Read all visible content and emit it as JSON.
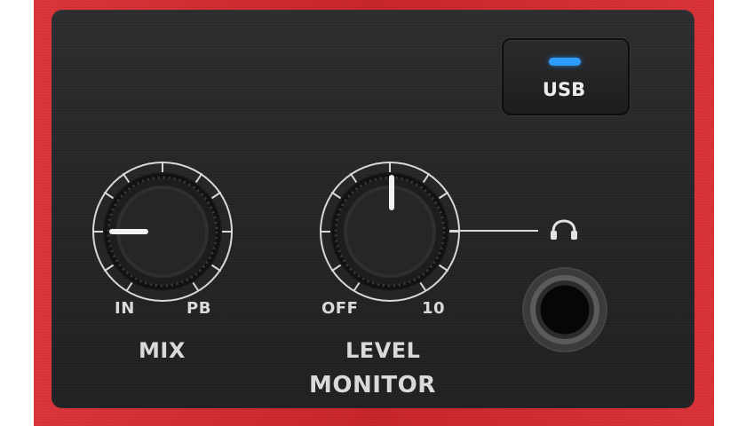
{
  "usb": {
    "label": "USB",
    "led_color": "#2d9cff"
  },
  "mix": {
    "title": "MIX",
    "min_label": "IN",
    "max_label": "PB",
    "level_fraction": 0
  },
  "monitor": {
    "level_title": "LEVEL",
    "section_title": "MONITOR",
    "min_label": "OFF",
    "max_label": "10",
    "level_fraction": 0.5
  },
  "icons": {
    "headphones": "headphones-icon",
    "jack": "audio-jack-icon"
  },
  "colors": {
    "chassis": "#d9272d",
    "panel": "#252527",
    "text": "#dadada",
    "indicator": "#f2f2f2"
  }
}
